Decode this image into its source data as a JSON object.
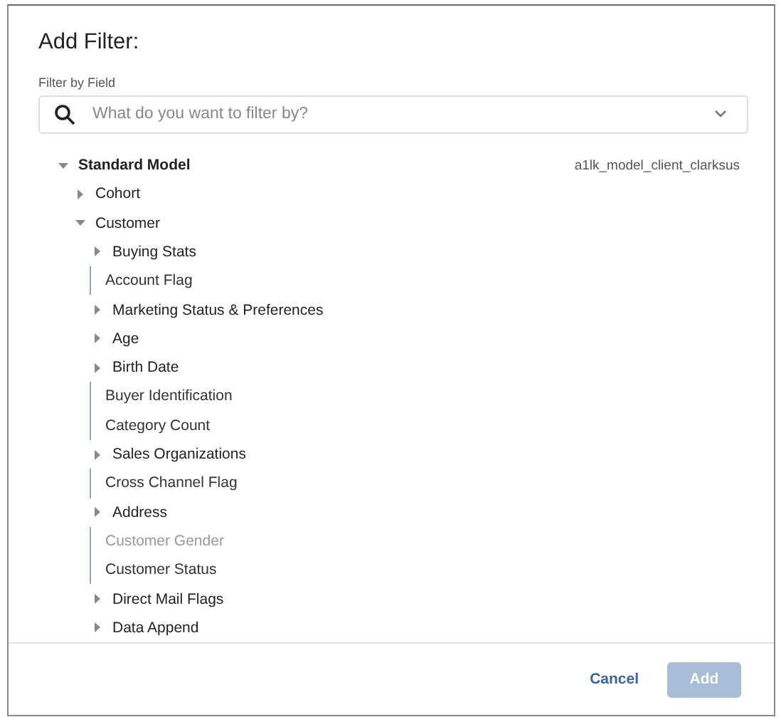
{
  "dialog": {
    "title": "Add Filter:"
  },
  "filter": {
    "label": "Filter by Field",
    "placeholder": "What do you want to filter by?"
  },
  "tree": [
    {
      "kind": "group",
      "label": "Standard Model",
      "expanded": true,
      "note": "a1lk_model_client_clarksus",
      "children": [
        {
          "kind": "group",
          "label": "Cohort",
          "expanded": false
        },
        {
          "kind": "group",
          "label": "Customer",
          "expanded": true,
          "children": [
            {
              "kind": "group",
              "label": "Buying Stats",
              "expanded": false
            },
            {
              "kind": "field",
              "label": "Account Flag",
              "disabled": false
            },
            {
              "kind": "group",
              "label": "Marketing Status & Preferences",
              "expanded": false
            },
            {
              "kind": "group",
              "label": "Age",
              "expanded": false
            },
            {
              "kind": "group",
              "label": "Birth Date",
              "expanded": false
            },
            {
              "kind": "field",
              "label": "Buyer Identification",
              "disabled": false
            },
            {
              "kind": "field",
              "label": "Category Count",
              "disabled": false
            },
            {
              "kind": "group",
              "label": "Sales Organizations",
              "expanded": false
            },
            {
              "kind": "field",
              "label": "Cross Channel Flag",
              "disabled": false
            },
            {
              "kind": "group",
              "label": "Address",
              "expanded": false
            },
            {
              "kind": "field",
              "label": "Customer Gender",
              "disabled": true
            },
            {
              "kind": "field",
              "label": "Customer Status",
              "disabled": false
            },
            {
              "kind": "group",
              "label": "Direct Mail Flags",
              "expanded": false
            },
            {
              "kind": "group",
              "label": "Data Append",
              "expanded": false
            }
          ]
        }
      ]
    }
  ],
  "buttons": [
    {
      "kind": "text",
      "label": "Cancel",
      "disabled": false
    },
    {
      "kind": "primary",
      "label": "Add",
      "disabled": true
    }
  ]
}
